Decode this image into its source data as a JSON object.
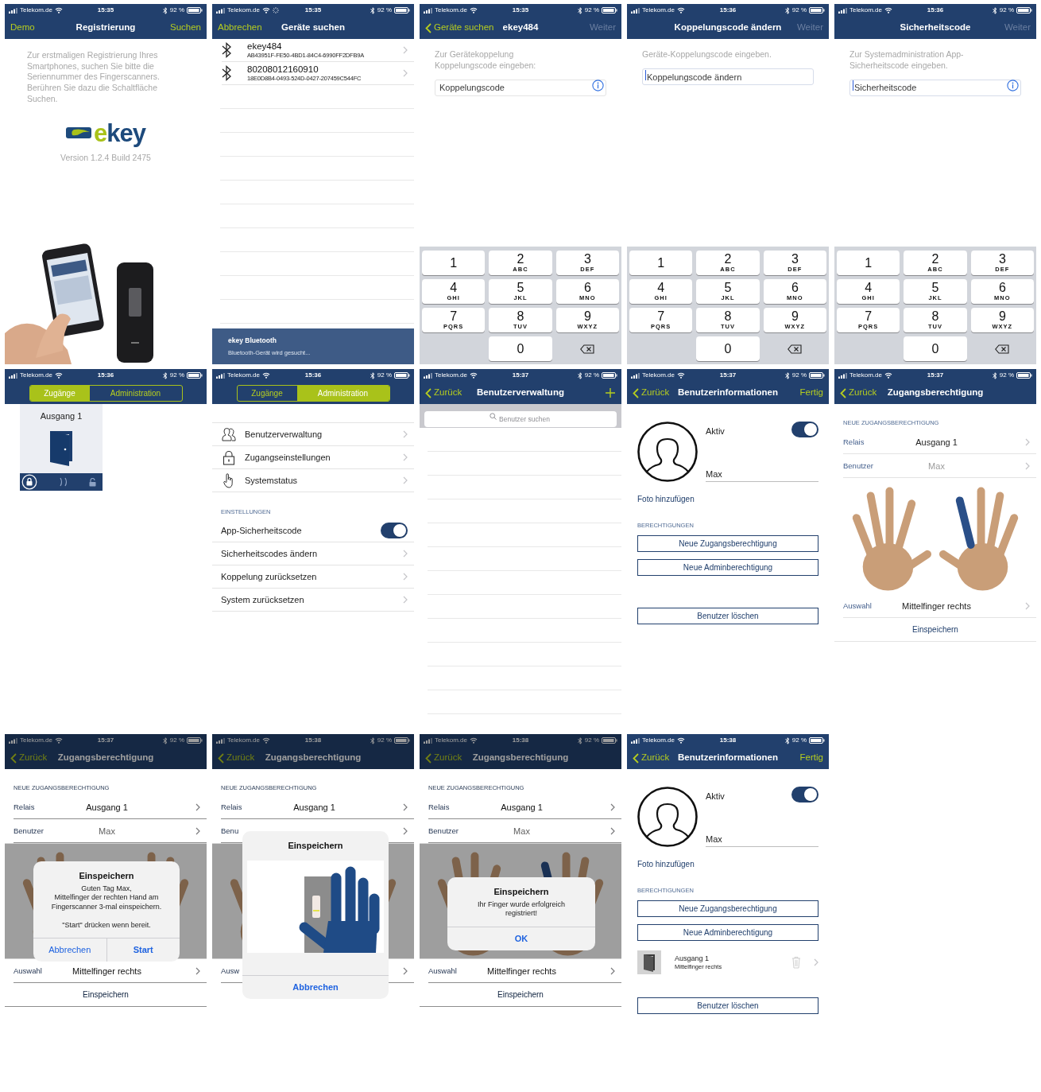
{
  "screens": [
    {
      "kind": "welcome",
      "status_bar": {
        "carrier": "Telekom.de",
        "time": "15:35",
        "battery": "92 %",
        "activity": false
      },
      "nav": {
        "left": {
          "text": "Demo",
          "back": false
        },
        "title": "Registrierung",
        "right": {
          "kind": "text",
          "text": "Suchen",
          "disabled": false
        }
      },
      "intro": "Zur erstmaligen Registrierung Ihres\nSmartphones, suchen Sie bitte die\nSeriennummer des Fingerscanners.\nBerühren Sie dazu die Schaltfläche\nSuchen.",
      "logo": {
        "parts": [
          {
            "text": "e",
            "color": "#a9c21a"
          },
          {
            "text": "key",
            "color": "#1d4a7c"
          }
        ]
      },
      "version": "Version 1.2.4 Build 2475"
    },
    {
      "kind": "device_search",
      "status_bar": {
        "carrier": "Telekom.de",
        "time": "15:35",
        "battery": "92 %",
        "activity": true
      },
      "nav": {
        "left": {
          "text": "Abbrechen",
          "back": false
        },
        "title": "Geräte suchen"
      },
      "devices": [
        {
          "name": "ekey484",
          "id": "AB43951F-FE50-4BD1-84C4-6990FF2DFB9A"
        },
        {
          "name": "80208012160910",
          "id": "18E0D8B4-0493-524D-0427-207459C544FC"
        }
      ],
      "banner": {
        "title": "ekey Bluetooth",
        "subtitle": "Bluetooth-Gerät wird gesucht..."
      }
    },
    {
      "kind": "code_entry",
      "status_bar": {
        "carrier": "Telekom.de",
        "time": "15:35",
        "battery": "92 %",
        "activity": false
      },
      "nav": {
        "left": {
          "text": "Geräte suchen",
          "back": true
        },
        "title": "ekey484",
        "right": {
          "kind": "text",
          "text": "Weiter",
          "disabled": true
        }
      },
      "hint": "Zur Gerätekoppelung\nKoppelungscode eingeben:",
      "field": {
        "placeholder": "Koppelungscode",
        "focused": false,
        "info": true
      },
      "keypad": [
        {
          "kind": "digit",
          "digit": "1"
        },
        {
          "kind": "digit",
          "digit": "2",
          "letters": "ABC"
        },
        {
          "kind": "digit",
          "digit": "3",
          "letters": "DEF"
        },
        {
          "kind": "digit",
          "digit": "4",
          "letters": "GHI"
        },
        {
          "kind": "digit",
          "digit": "5",
          "letters": "JKL"
        },
        {
          "kind": "digit",
          "digit": "6",
          "letters": "MNO"
        },
        {
          "kind": "digit",
          "digit": "7",
          "letters": "PQRS"
        },
        {
          "kind": "digit",
          "digit": "8",
          "letters": "TUV"
        },
        {
          "kind": "digit",
          "digit": "9",
          "letters": "WXYZ"
        },
        {
          "kind": "blank"
        },
        {
          "kind": "digit",
          "digit": "0"
        },
        {
          "kind": "delete"
        }
      ]
    },
    {
      "kind": "code_entry",
      "status_bar": {
        "carrier": "Telekom.de",
        "time": "15:36",
        "battery": "92 %",
        "activity": false
      },
      "nav": {
        "title": "Koppelungscode ändern",
        "right": {
          "kind": "text",
          "text": "Weiter",
          "disabled": true
        }
      },
      "hint": "Geräte-Koppelungscode eingeben.",
      "field": {
        "placeholder": "Koppelungscode ändern",
        "focused": true,
        "info": false
      },
      "keypad": [
        {
          "kind": "digit",
          "digit": "1"
        },
        {
          "kind": "digit",
          "digit": "2",
          "letters": "ABC"
        },
        {
          "kind": "digit",
          "digit": "3",
          "letters": "DEF"
        },
        {
          "kind": "digit",
          "digit": "4",
          "letters": "GHI"
        },
        {
          "kind": "digit",
          "digit": "5",
          "letters": "JKL"
        },
        {
          "kind": "digit",
          "digit": "6",
          "letters": "MNO"
        },
        {
          "kind": "digit",
          "digit": "7",
          "letters": "PQRS"
        },
        {
          "kind": "digit",
          "digit": "8",
          "letters": "TUV"
        },
        {
          "kind": "digit",
          "digit": "9",
          "letters": "WXYZ"
        },
        {
          "kind": "blank"
        },
        {
          "kind": "digit",
          "digit": "0"
        },
        {
          "kind": "delete"
        }
      ]
    },
    {
      "kind": "code_entry",
      "status_bar": {
        "carrier": "Telekom.de",
        "time": "15:36",
        "battery": "92 %",
        "activity": false
      },
      "nav": {
        "title": "Sicherheitscode",
        "right": {
          "kind": "text",
          "text": "Weiter",
          "disabled": true
        }
      },
      "hint": "Zur Systemadministration App-\nSicherheitscode eingeben.",
      "field": {
        "placeholder": "Sicherheitscode",
        "focused": true,
        "info": true
      },
      "keypad": [
        {
          "kind": "digit",
          "digit": "1"
        },
        {
          "kind": "digit",
          "digit": "2",
          "letters": "ABC"
        },
        {
          "kind": "digit",
          "digit": "3",
          "letters": "DEF"
        },
        {
          "kind": "digit",
          "digit": "4",
          "letters": "GHI"
        },
        {
          "kind": "digit",
          "digit": "5",
          "letters": "JKL"
        },
        {
          "kind": "digit",
          "digit": "6",
          "letters": "MNO"
        },
        {
          "kind": "digit",
          "digit": "7",
          "letters": "PQRS"
        },
        {
          "kind": "digit",
          "digit": "8",
          "letters": "TUV"
        },
        {
          "kind": "digit",
          "digit": "9",
          "letters": "WXYZ"
        },
        {
          "kind": "blank"
        },
        {
          "kind": "digit",
          "digit": "0"
        },
        {
          "kind": "delete"
        }
      ]
    },
    {
      "kind": "accesses",
      "status_bar": {
        "carrier": "Telekom.de",
        "time": "15:36",
        "battery": "92 %",
        "activity": false
      },
      "segments": [
        {
          "label": "Zugänge",
          "selected": true
        },
        {
          "label": "Administration",
          "selected": false
        }
      ],
      "tiles": [
        {
          "title": "Ausgang 1"
        }
      ]
    },
    {
      "kind": "administration",
      "status_bar": {
        "carrier": "Telekom.de",
        "time": "15:36",
        "battery": "92 %",
        "activity": false
      },
      "segments": [
        {
          "label": "Zugänge",
          "selected": false
        },
        {
          "label": "Administration",
          "selected": true
        }
      ],
      "menu": [
        {
          "label": "Benutzerverwaltung"
        },
        {
          "label": "Zugangseinstellungen"
        },
        {
          "label": "Systemstatus"
        }
      ],
      "section": "EINSTELLUNGEN",
      "settings": [
        {
          "kind": "toggle",
          "label": "App-Sicherheitscode",
          "on": true
        },
        {
          "kind": "link",
          "label": "Sicherheitscodes ändern"
        },
        {
          "kind": "link",
          "label": "Koppelung zurücksetzen"
        },
        {
          "kind": "link",
          "label": "System zurücksetzen"
        }
      ]
    },
    {
      "kind": "user_list",
      "status_bar": {
        "carrier": "Telekom.de",
        "time": "15:37",
        "battery": "92 %",
        "activity": false
      },
      "nav": {
        "left": {
          "text": "Zurück",
          "back": true
        },
        "title": "Benutzerverwaltung",
        "right": {
          "kind": "add"
        }
      },
      "search": {
        "placeholder": "Benutzer suchen"
      }
    },
    {
      "kind": "user_info",
      "status_bar": {
        "carrier": "Telekom.de",
        "time": "15:37",
        "battery": "92 %",
        "activity": false
      },
      "nav": {
        "left": {
          "text": "Zurück",
          "back": true
        },
        "title": "Benutzerinformationen",
        "right": {
          "kind": "text",
          "text": "Fertig",
          "disabled": false
        }
      },
      "active": {
        "label": "Aktiv",
        "on": true
      },
      "name": "Max",
      "photo_link": "Foto hinzufügen",
      "section": "BERECHTIGUNGEN",
      "buttons": [
        "Neue Zugangsberechtigung",
        "Neue Adminberechtigung"
      ],
      "delete_button": "Benutzer löschen"
    },
    {
      "kind": "access_permission",
      "status_bar": {
        "carrier": "Telekom.de",
        "time": "15:37",
        "battery": "92 %",
        "activity": false
      },
      "nav": {
        "left": {
          "text": "Zurück",
          "back": true
        },
        "title": "Zugangsberechtigung"
      },
      "section": "NEUE ZUGANGSBERECHTIGUNG",
      "rows": [
        {
          "label": "Relais",
          "value": "Ausgang 1",
          "muted": false
        },
        {
          "label": "Benutzer",
          "value": "Max",
          "muted": true
        }
      ],
      "rows_after": [
        {
          "label": "Auswahl",
          "value": "Mittelfinger rechts",
          "muted": false
        }
      ],
      "action": "Einspeichern"
    },
    {
      "kind": "access_permission",
      "status_bar": {
        "carrier": "Telekom.de",
        "time": "15:37",
        "battery": "92 %",
        "activity": false
      },
      "nav": {
        "left": {
          "text": "Zurück",
          "back": true
        },
        "title": "Zugangsberechtigung"
      },
      "section": "NEUE ZUGANGSBERECHTIGUNG",
      "rows": [
        {
          "label": "Relais",
          "value": "Ausgang 1",
          "muted": false
        },
        {
          "label": "Benutzer",
          "value": "Max",
          "muted": true
        }
      ],
      "rows_after": [
        {
          "label": "Auswahl",
          "value": "Mittelfinger rechts",
          "muted": false
        }
      ],
      "action": "Einspeichern",
      "dialog": {
        "kind": "confirm",
        "title": "Einspeichern",
        "message": "Guten Tag Max,\nMittelfinger der rechten Hand am\nFingerscanner 3-mal einspeichern.\n\n\"Start\" drücken wenn bereit.",
        "buttons": [
          {
            "label": "Abbrechen",
            "preferred": false
          },
          {
            "label": "Start",
            "preferred": true
          }
        ]
      }
    },
    {
      "kind": "access_permission",
      "status_bar": {
        "carrier": "Telekom.de",
        "time": "15:38",
        "battery": "92 %",
        "activity": false
      },
      "nav": {
        "left": {
          "text": "Zurück",
          "back": true
        },
        "title": "Zugangsberechtigung"
      },
      "section": "NEUE ZUGANGSBERECHTIGUNG",
      "rows": [
        {
          "label": "Relais",
          "value": "Ausgang 1",
          "muted": false
        },
        {
          "label": "Benu"
        }
      ],
      "rows_after": [
        {
          "label": "Ausw"
        }
      ],
      "dialog": {
        "title": "Einspeichern",
        "buttons": [
          {
            "label": "Abbrechen",
            "preferred": true
          }
        ]
      }
    },
    {
      "kind": "access_permission",
      "status_bar": {
        "carrier": "Telekom.de",
        "time": "15:38",
        "battery": "92 %",
        "activity": false
      },
      "nav": {
        "left": {
          "text": "Zurück",
          "back": true
        },
        "title": "Zugangsberechtigung"
      },
      "section": "NEUE ZUGANGSBERECHTIGUNG",
      "rows": [
        {
          "label": "Relais",
          "value": "Ausgang 1",
          "muted": false
        },
        {
          "label": "Benutzer",
          "value": "Max",
          "muted": true
        }
      ],
      "rows_after": [
        {
          "label": "Auswahl",
          "value": "Mittelfinger rechts",
          "muted": false
        }
      ],
      "action": "Einspeichern",
      "dialog": {
        "kind": "message",
        "title": "Einspeichern",
        "message": "Ihr Finger wurde erfolgreich\nregistriert!",
        "buttons": [
          {
            "label": "OK",
            "preferred": true
          }
        ]
      }
    },
    {
      "kind": "user_info",
      "status_bar": {
        "carrier": "Telekom.de",
        "time": "15:38",
        "battery": "92 %",
        "activity": false
      },
      "nav": {
        "left": {
          "text": "Zurück",
          "back": true
        },
        "title": "Benutzerinformationen",
        "right": {
          "kind": "text",
          "text": "Fertig",
          "disabled": false
        }
      },
      "active": {
        "label": "Aktiv",
        "on": true
      },
      "name": "Max",
      "photo_link": "Foto hinzufügen",
      "section": "BERECHTIGUNGEN",
      "buttons": [
        "Neue Zugangsberechtigung",
        "Neue Adminberechtigung"
      ],
      "permissions": [
        {
          "title": "Ausgang 1",
          "detail": "Mittelfinger rechts"
        }
      ],
      "delete_button": "Benutzer löschen"
    }
  ]
}
